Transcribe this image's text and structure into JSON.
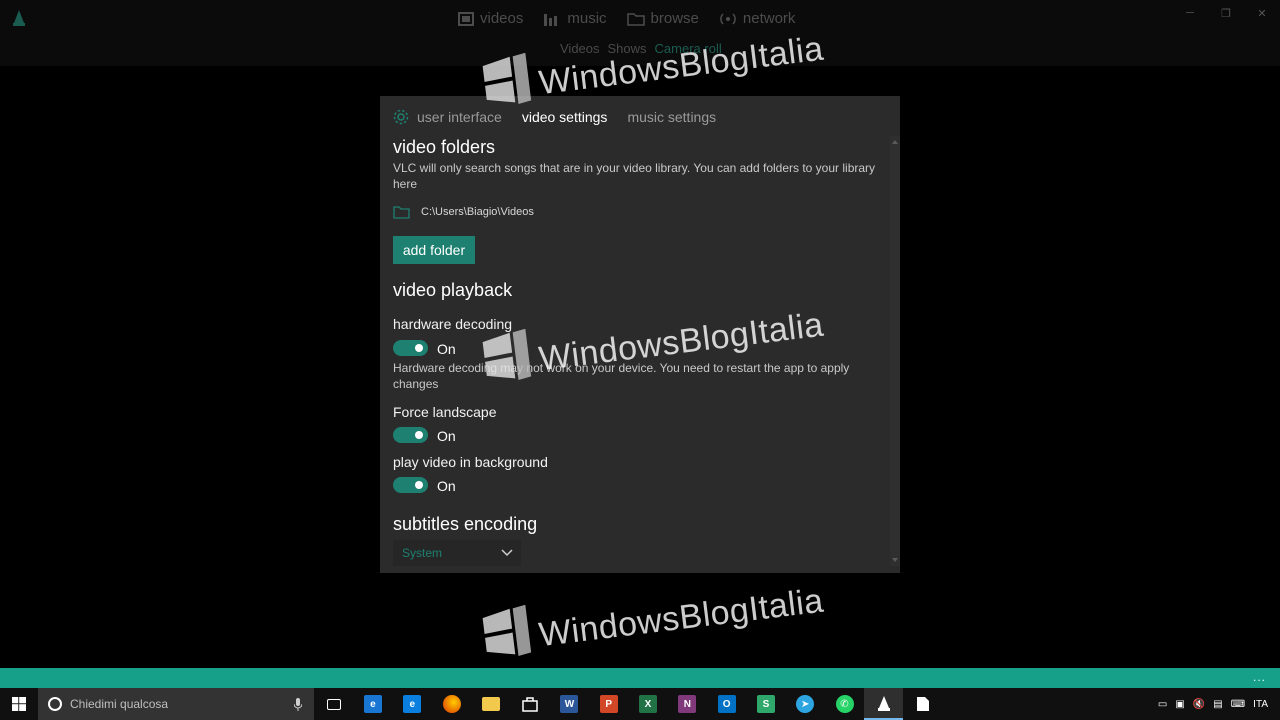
{
  "top_nav": {
    "items": [
      {
        "label": "videos",
        "icon": "videos-icon"
      },
      {
        "label": "music",
        "icon": "music-icon"
      },
      {
        "label": "browse",
        "icon": "folder-icon"
      },
      {
        "label": "network",
        "icon": "network-icon"
      }
    ],
    "sub_items": [
      "Videos",
      "Shows",
      "Camera roll"
    ]
  },
  "window_controls": {
    "minimize": "─",
    "restore": "❐",
    "close": "✕"
  },
  "settings": {
    "tabs": [
      "user interface",
      "video settings",
      "music settings"
    ],
    "active_tab": "video settings",
    "video_folders": {
      "title": "video folders",
      "description": "VLC will only search songs that are in your video library. You can add folders to your library here",
      "folder_path": "C:\\Users\\Biagio\\Videos",
      "add_button": "add folder"
    },
    "video_playback": {
      "title": "video playback",
      "hardware_decoding": {
        "label": "hardware decoding",
        "state": "On",
        "note": "Hardware decoding may not work on your device. You need to restart the app to apply changes"
      },
      "force_landscape": {
        "label": "Force landscape",
        "state": "On"
      },
      "play_background": {
        "label": "play video in background",
        "state": "On"
      }
    },
    "subtitles": {
      "title": "subtitles encoding",
      "selected": "System"
    }
  },
  "watermark": "WindowsBlogItalia",
  "taskbar": {
    "search_placeholder": "Chiedimi qualcosa",
    "apps": [
      {
        "name": "task-view-icon",
        "glyph": "",
        "color": "#101010"
      },
      {
        "name": "edge-icon",
        "glyph": "e",
        "color": "#1976d2"
      },
      {
        "name": "ie-icon",
        "glyph": "e",
        "color": "#0a7fe0"
      },
      {
        "name": "firefox-icon",
        "glyph": "",
        "color": "#e66000"
      },
      {
        "name": "file-explorer-icon",
        "glyph": "",
        "color": "#f2c94c"
      },
      {
        "name": "store-icon",
        "glyph": "",
        "color": "#101010"
      },
      {
        "name": "word-icon",
        "glyph": "W",
        "color": "#2b579a"
      },
      {
        "name": "powerpoint-icon",
        "glyph": "P",
        "color": "#d24726"
      },
      {
        "name": "excel-icon",
        "glyph": "X",
        "color": "#217346"
      },
      {
        "name": "onenote-icon",
        "glyph": "N",
        "color": "#80397b"
      },
      {
        "name": "outlook-icon",
        "glyph": "O",
        "color": "#0072c6"
      },
      {
        "name": "sway-icon",
        "glyph": "S",
        "color": "#2fa86c"
      },
      {
        "name": "telegram-icon",
        "glyph": "➤",
        "color": "#2ca5e0"
      },
      {
        "name": "whatsapp-icon",
        "glyph": "✆",
        "color": "#25d366"
      },
      {
        "name": "vlc-icon",
        "glyph": "",
        "color": "#2f2f2f"
      },
      {
        "name": "document-icon",
        "glyph": "",
        "color": "#101010"
      }
    ],
    "tray_lang": "ITA"
  },
  "accent_dots": "..."
}
